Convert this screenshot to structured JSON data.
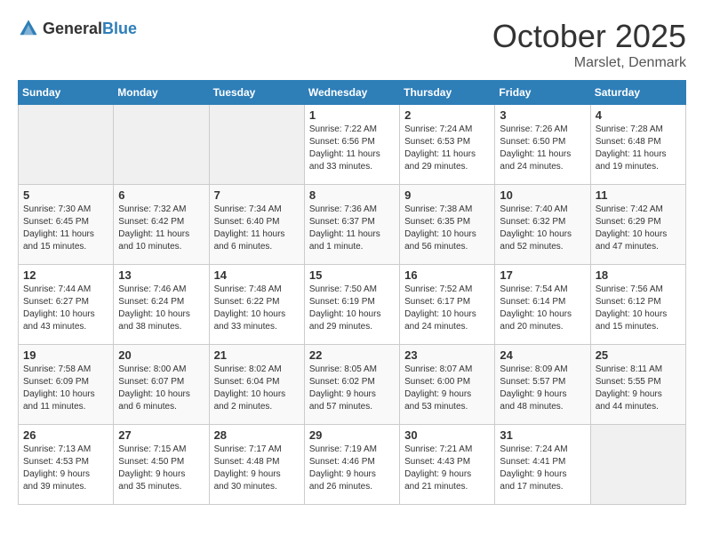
{
  "header": {
    "logo_general": "General",
    "logo_blue": "Blue",
    "month": "October 2025",
    "location": "Marslet, Denmark"
  },
  "days_of_week": [
    "Sunday",
    "Monday",
    "Tuesday",
    "Wednesday",
    "Thursday",
    "Friday",
    "Saturday"
  ],
  "weeks": [
    [
      {
        "day": "",
        "content": ""
      },
      {
        "day": "",
        "content": ""
      },
      {
        "day": "",
        "content": ""
      },
      {
        "day": "1",
        "content": "Sunrise: 7:22 AM\nSunset: 6:56 PM\nDaylight: 11 hours\nand 33 minutes."
      },
      {
        "day": "2",
        "content": "Sunrise: 7:24 AM\nSunset: 6:53 PM\nDaylight: 11 hours\nand 29 minutes."
      },
      {
        "day": "3",
        "content": "Sunrise: 7:26 AM\nSunset: 6:50 PM\nDaylight: 11 hours\nand 24 minutes."
      },
      {
        "day": "4",
        "content": "Sunrise: 7:28 AM\nSunset: 6:48 PM\nDaylight: 11 hours\nand 19 minutes."
      }
    ],
    [
      {
        "day": "5",
        "content": "Sunrise: 7:30 AM\nSunset: 6:45 PM\nDaylight: 11 hours\nand 15 minutes."
      },
      {
        "day": "6",
        "content": "Sunrise: 7:32 AM\nSunset: 6:42 PM\nDaylight: 11 hours\nand 10 minutes."
      },
      {
        "day": "7",
        "content": "Sunrise: 7:34 AM\nSunset: 6:40 PM\nDaylight: 11 hours\nand 6 minutes."
      },
      {
        "day": "8",
        "content": "Sunrise: 7:36 AM\nSunset: 6:37 PM\nDaylight: 11 hours\nand 1 minute."
      },
      {
        "day": "9",
        "content": "Sunrise: 7:38 AM\nSunset: 6:35 PM\nDaylight: 10 hours\nand 56 minutes."
      },
      {
        "day": "10",
        "content": "Sunrise: 7:40 AM\nSunset: 6:32 PM\nDaylight: 10 hours\nand 52 minutes."
      },
      {
        "day": "11",
        "content": "Sunrise: 7:42 AM\nSunset: 6:29 PM\nDaylight: 10 hours\nand 47 minutes."
      }
    ],
    [
      {
        "day": "12",
        "content": "Sunrise: 7:44 AM\nSunset: 6:27 PM\nDaylight: 10 hours\nand 43 minutes."
      },
      {
        "day": "13",
        "content": "Sunrise: 7:46 AM\nSunset: 6:24 PM\nDaylight: 10 hours\nand 38 minutes."
      },
      {
        "day": "14",
        "content": "Sunrise: 7:48 AM\nSunset: 6:22 PM\nDaylight: 10 hours\nand 33 minutes."
      },
      {
        "day": "15",
        "content": "Sunrise: 7:50 AM\nSunset: 6:19 PM\nDaylight: 10 hours\nand 29 minutes."
      },
      {
        "day": "16",
        "content": "Sunrise: 7:52 AM\nSunset: 6:17 PM\nDaylight: 10 hours\nand 24 minutes."
      },
      {
        "day": "17",
        "content": "Sunrise: 7:54 AM\nSunset: 6:14 PM\nDaylight: 10 hours\nand 20 minutes."
      },
      {
        "day": "18",
        "content": "Sunrise: 7:56 AM\nSunset: 6:12 PM\nDaylight: 10 hours\nand 15 minutes."
      }
    ],
    [
      {
        "day": "19",
        "content": "Sunrise: 7:58 AM\nSunset: 6:09 PM\nDaylight: 10 hours\nand 11 minutes."
      },
      {
        "day": "20",
        "content": "Sunrise: 8:00 AM\nSunset: 6:07 PM\nDaylight: 10 hours\nand 6 minutes."
      },
      {
        "day": "21",
        "content": "Sunrise: 8:02 AM\nSunset: 6:04 PM\nDaylight: 10 hours\nand 2 minutes."
      },
      {
        "day": "22",
        "content": "Sunrise: 8:05 AM\nSunset: 6:02 PM\nDaylight: 9 hours\nand 57 minutes."
      },
      {
        "day": "23",
        "content": "Sunrise: 8:07 AM\nSunset: 6:00 PM\nDaylight: 9 hours\nand 53 minutes."
      },
      {
        "day": "24",
        "content": "Sunrise: 8:09 AM\nSunset: 5:57 PM\nDaylight: 9 hours\nand 48 minutes."
      },
      {
        "day": "25",
        "content": "Sunrise: 8:11 AM\nSunset: 5:55 PM\nDaylight: 9 hours\nand 44 minutes."
      }
    ],
    [
      {
        "day": "26",
        "content": "Sunrise: 7:13 AM\nSunset: 4:53 PM\nDaylight: 9 hours\nand 39 minutes."
      },
      {
        "day": "27",
        "content": "Sunrise: 7:15 AM\nSunset: 4:50 PM\nDaylight: 9 hours\nand 35 minutes."
      },
      {
        "day": "28",
        "content": "Sunrise: 7:17 AM\nSunset: 4:48 PM\nDaylight: 9 hours\nand 30 minutes."
      },
      {
        "day": "29",
        "content": "Sunrise: 7:19 AM\nSunset: 4:46 PM\nDaylight: 9 hours\nand 26 minutes."
      },
      {
        "day": "30",
        "content": "Sunrise: 7:21 AM\nSunset: 4:43 PM\nDaylight: 9 hours\nand 21 minutes."
      },
      {
        "day": "31",
        "content": "Sunrise: 7:24 AM\nSunset: 4:41 PM\nDaylight: 9 hours\nand 17 minutes."
      },
      {
        "day": "",
        "content": ""
      }
    ]
  ]
}
